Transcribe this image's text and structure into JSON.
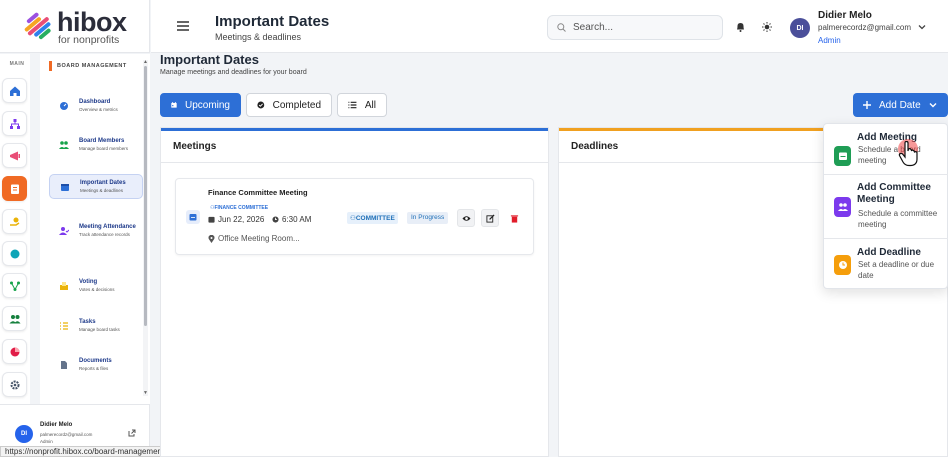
{
  "brand": {
    "name": "hibox",
    "tagline": "for nonprofits"
  },
  "rail": {
    "section_label": "MAIN"
  },
  "subnav": {
    "section_label": "BOARD MANAGEMENT",
    "items": [
      {
        "title": "Dashboard",
        "desc": "Overview & metrics"
      },
      {
        "title": "Board Members",
        "desc": "Manage board members"
      },
      {
        "title": "Important Dates",
        "desc": "Meetings & deadlines"
      },
      {
        "title": "Meeting Attendance",
        "desc": "Track attendance records"
      },
      {
        "title": "Voting",
        "desc": "Votes & decisions"
      },
      {
        "title": "Tasks",
        "desc": "Manage board tasks"
      },
      {
        "title": "Documents",
        "desc": "Reports & files"
      }
    ]
  },
  "footer_user": {
    "initials": "DI",
    "name": "Didier Melo",
    "email": "palmerecordz@gmail.com",
    "role": "Admin"
  },
  "status_url": "https://nonprofit.hibox.co/board-management/meetings#",
  "header": {
    "title": "Important Dates",
    "subtitle": "Meetings & deadlines",
    "search_placeholder": "Search...",
    "user": {
      "initials": "DI",
      "name": "Didier Melo",
      "email": "palmerecordz@gmail.com",
      "role": "Admin"
    }
  },
  "page": {
    "title": "Important Dates",
    "subtitle": "Manage meetings and deadlines for your board"
  },
  "tabs": [
    {
      "label": "Upcoming"
    },
    {
      "label": "Completed"
    },
    {
      "label": "All"
    }
  ],
  "add_date_label": "Add Date",
  "panels": {
    "meetings": "Meetings",
    "deadlines": "Deadlines"
  },
  "meeting": {
    "title": "Finance Committee Meeting",
    "category": "FINANCE COMMITTEE",
    "date": "Jun 22, 2026",
    "time": "6:30 AM",
    "location": "Office Meeting Room...",
    "badge": "COMMITTEE",
    "status": "In Progress"
  },
  "dropdown": [
    {
      "title": "Add Meeting",
      "desc": "Schedule a board meeting",
      "color": "#1f9d55"
    },
    {
      "title": "Add Committee Meeting",
      "desc": "Schedule a committee meeting",
      "color": "#7c3aed"
    },
    {
      "title": "Add Deadline",
      "desc": "Set a deadline or due date",
      "color": "#f59e0b"
    }
  ],
  "colors": {
    "accent": "#2d6fd6",
    "brand_orange": "#f06a24",
    "meetings_bar": "#2d6fd6",
    "deadlines_bar": "#f0a020"
  }
}
